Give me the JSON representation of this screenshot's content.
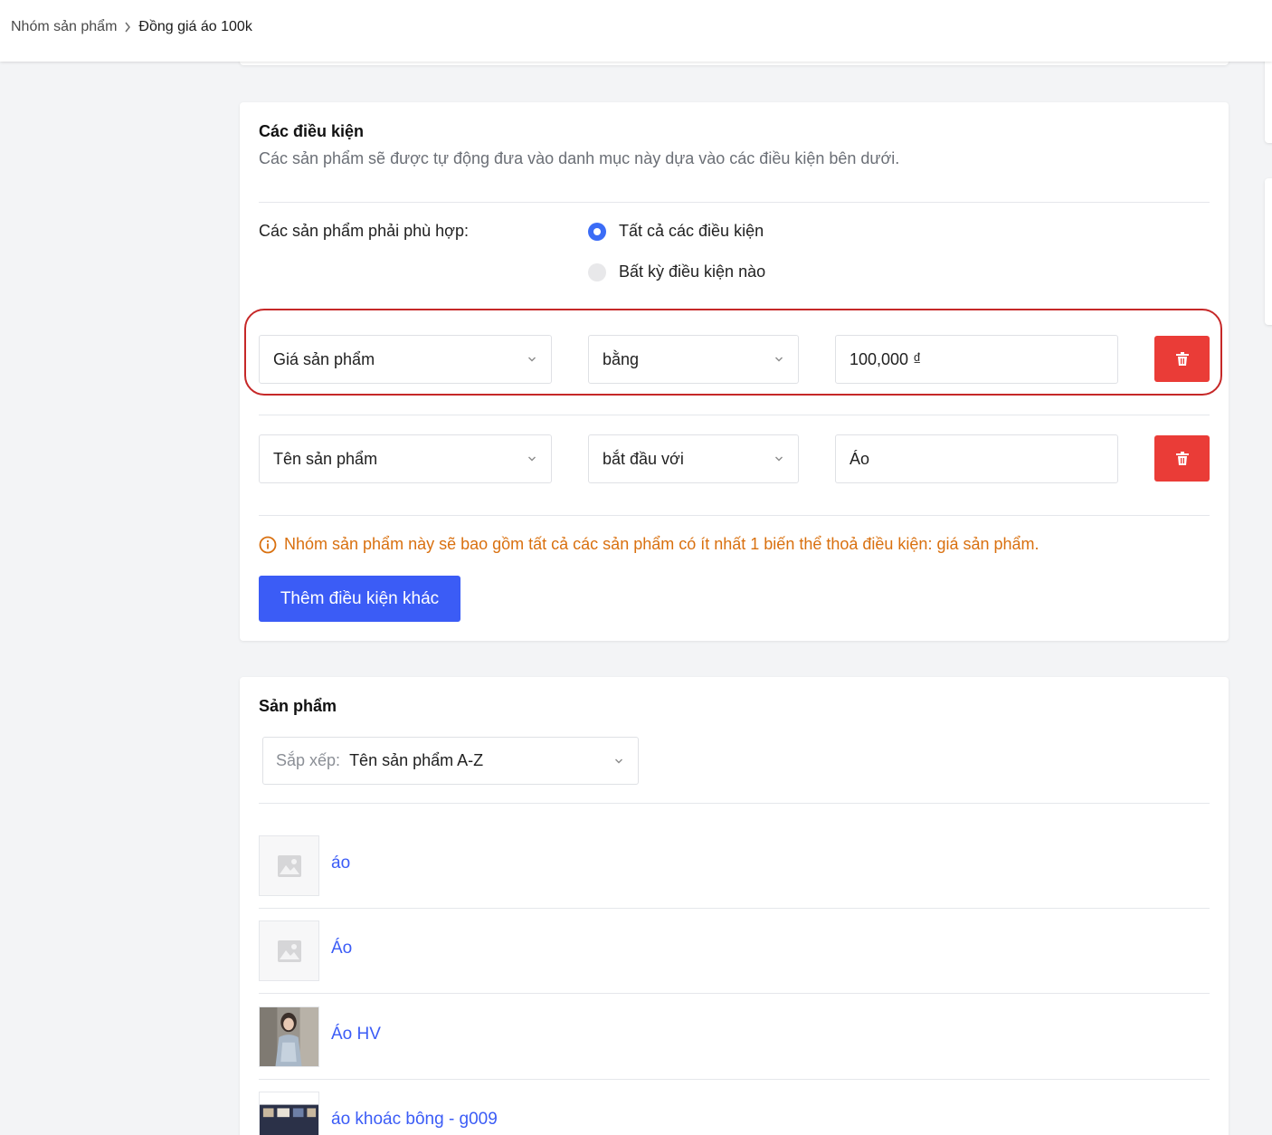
{
  "breadcrumb": {
    "parent": "Nhóm sản phẩm",
    "current": "Đồng giá áo 100k"
  },
  "conditions": {
    "title": "Các điều kiện",
    "description": "Các sản phẩm sẽ được tự động đưa vào danh mục này dựa vào các điều kiện bên dưới.",
    "match_label": "Các sản phẩm phải phù hợp:",
    "match_options": [
      {
        "label": "Tất cả các điều kiện",
        "checked": true
      },
      {
        "label": "Bất kỳ điều kiện nào",
        "checked": false
      }
    ],
    "rules": [
      {
        "field": "Giá sản phẩm",
        "operator": "bằng",
        "value": "100,000 ₫"
      },
      {
        "field": "Tên sản phẩm",
        "operator": "bắt đầu với",
        "value": "Áo"
      }
    ],
    "warning": "Nhóm sản phẩm này sẽ bao gồm tất cả các sản phẩm có ít nhất 1 biến thể thoả điều kiện: giá sản phẩm.",
    "add_button": "Thêm điều kiện khác"
  },
  "products": {
    "title": "Sản phẩm",
    "sort_prefix": "Sắp xếp:",
    "sort_value": "Tên sản phẩm A-Z",
    "items": [
      {
        "name": "áo",
        "thumb": "placeholder"
      },
      {
        "name": "Áo",
        "thumb": "placeholder"
      },
      {
        "name": "Áo HV",
        "thumb": "photo"
      },
      {
        "name": "áo khoác bông - g009",
        "thumb": "photo"
      }
    ]
  },
  "colors": {
    "primary": "#3b5cf6",
    "danger": "#ea3c37",
    "warning": "#d9700f",
    "highlight": "#c62828"
  }
}
